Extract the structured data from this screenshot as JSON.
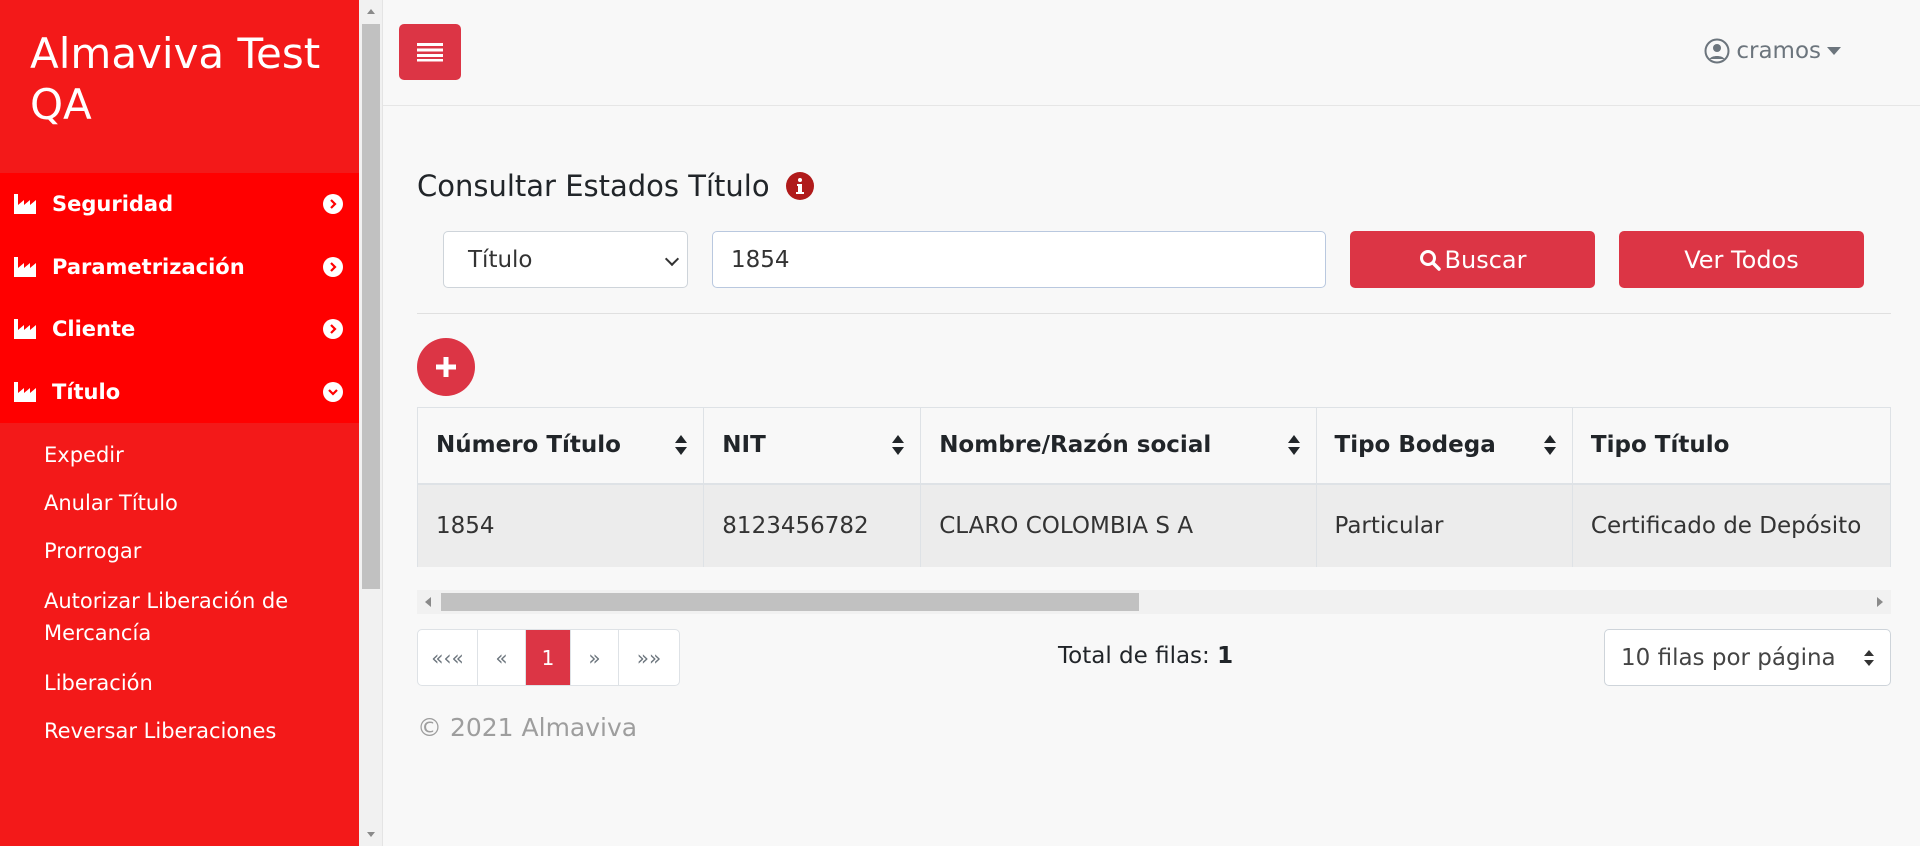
{
  "brand": {
    "title": "Almaviva Test QA"
  },
  "sidebar": {
    "items": [
      {
        "label": "Seguridad",
        "icon": "factory-icon",
        "expanded": false
      },
      {
        "label": "Parametrización",
        "icon": "factory-icon",
        "expanded": false
      },
      {
        "label": "Cliente",
        "icon": "factory-icon",
        "expanded": false
      },
      {
        "label": "Título",
        "icon": "factory-icon",
        "expanded": true
      }
    ],
    "submenu": [
      {
        "label": "Expedir"
      },
      {
        "label": "Anular Título"
      },
      {
        "label": "Prorrogar"
      },
      {
        "label": "Autorizar Liberación de Mercancía"
      },
      {
        "label": "Liberación"
      },
      {
        "label": "Reversar Liberaciones"
      }
    ]
  },
  "header": {
    "user": "cramos"
  },
  "main": {
    "title": "Consultar Estados Título",
    "filter": {
      "selected": "Título",
      "search_value": "1854"
    },
    "buttons": {
      "search": "Buscar",
      "view_all": "Ver Todos"
    },
    "table": {
      "columns": [
        "Número Título",
        "NIT",
        "Nombre/Razón social",
        "Tipo Bodega",
        "Tipo Título"
      ],
      "rows": [
        [
          "1854",
          "8123456782",
          "CLARO COLOMBIA S A",
          "Particular",
          "Certificado de Depósito"
        ]
      ]
    },
    "pagination": {
      "first": "«‹«",
      "prev": "«",
      "current": "1",
      "next": "»",
      "last": "»»"
    },
    "total_label": "Total de filas:",
    "total_value": "1",
    "rows_per_page": "10 filas por página",
    "footer": "© 2021 Almaviva"
  },
  "colors": {
    "sidebar": "#f31919",
    "menu": "#ff0000",
    "accent": "#dc3545",
    "info": "#b01a1a"
  }
}
